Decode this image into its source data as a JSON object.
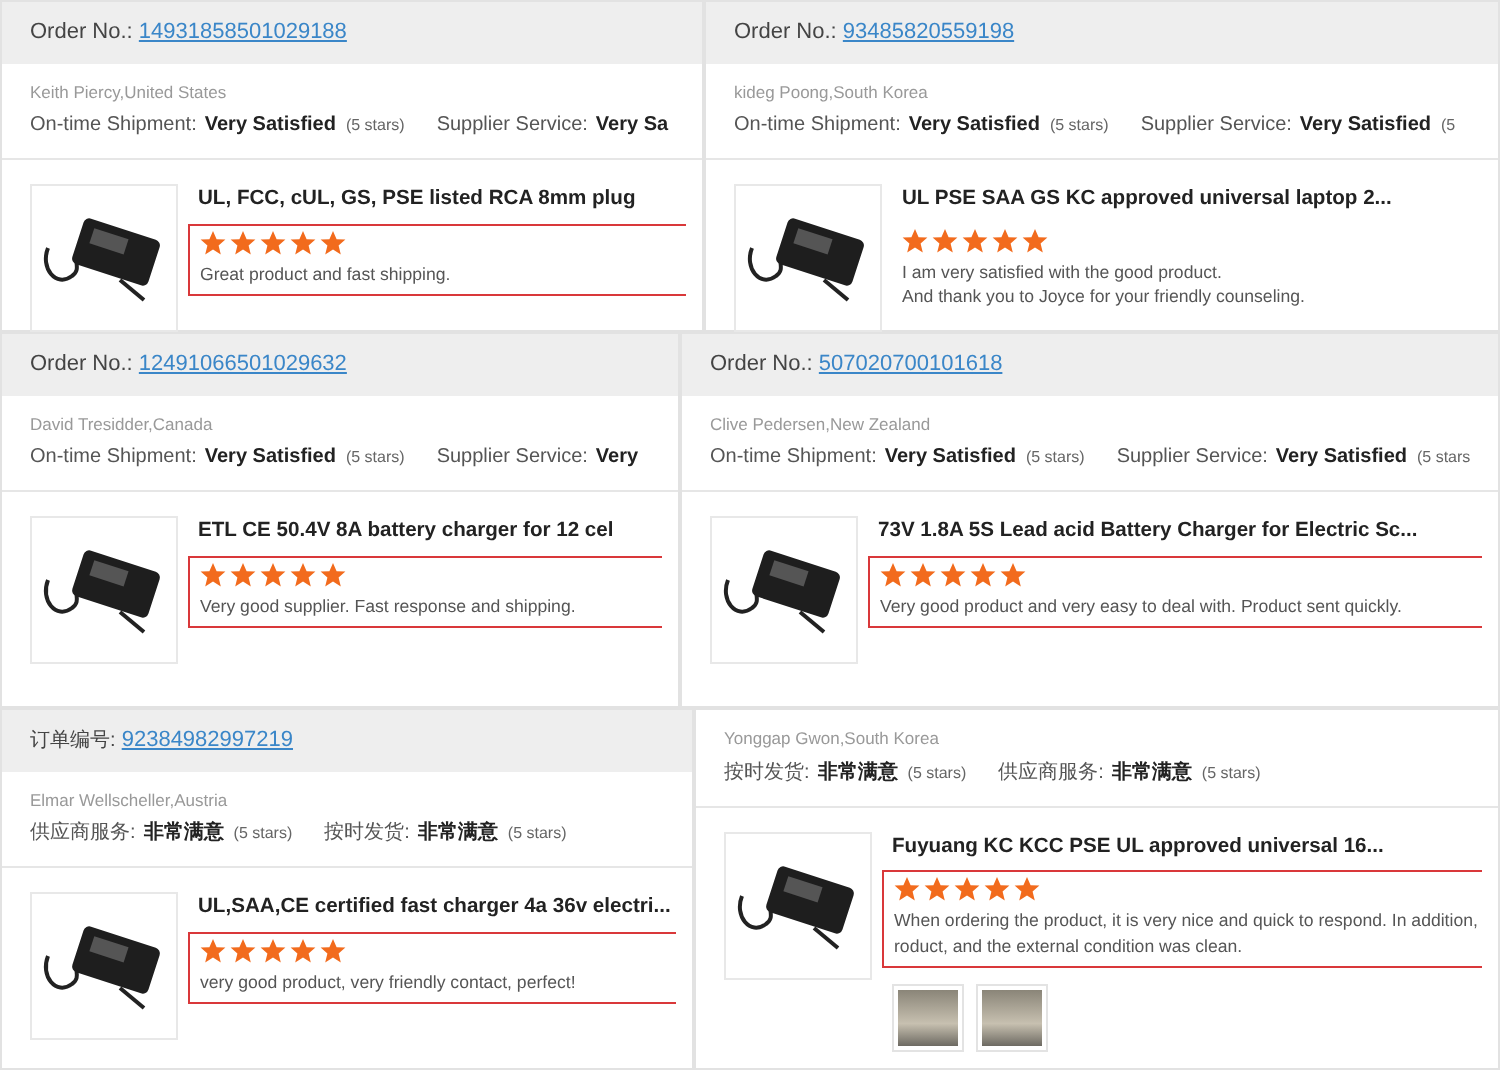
{
  "rows": [
    {
      "cards": [
        {
          "order": {
            "label": "Order No.:",
            "number": "14931858501029188"
          },
          "reviewer": "Keith Piercy,United States",
          "ratings": [
            {
              "label": "On-time Shipment:",
              "value": "Very Satisfied",
              "note": "(5 stars)"
            },
            {
              "label": "Supplier Service:",
              "value": "Very Sa"
            }
          ],
          "product": {
            "title": "UL, FCC, cUL, GS, PSE listed RCA 8mm plug",
            "stars": 5,
            "review": [
              "Great product and fast shipping."
            ],
            "framed": true
          }
        },
        {
          "order": {
            "label": "Order No.:",
            "number": "93485820559198"
          },
          "reviewer": "kideg Poong,South Korea",
          "ratings": [
            {
              "label": "On-time Shipment:",
              "value": "Very Satisfied",
              "note": "(5 stars)"
            },
            {
              "label": "Supplier Service:",
              "value": "Very Satisfied",
              "note": "(5"
            }
          ],
          "product": {
            "title": "UL PSE SAA GS KC approved universal laptop 2...",
            "stars": 5,
            "review": [
              "I am very satisfied with the good product.",
              "And thank you to Joyce for your friendly counseling."
            ],
            "framed": false
          }
        }
      ]
    },
    {
      "cards": [
        {
          "order": {
            "label": "Order No.:",
            "number": "12491066501029632"
          },
          "reviewer": "David Tresidder,Canada",
          "ratings": [
            {
              "label": "On-time Shipment:",
              "value": "Very Satisfied",
              "note": "(5 stars)"
            },
            {
              "label": "Supplier Service:",
              "value": "Very"
            }
          ],
          "product": {
            "title": "ETL CE 50.4V 8A battery charger for 12 cel",
            "stars": 5,
            "review": [
              "Very good supplier. Fast response and shipping."
            ],
            "framed": true
          }
        },
        {
          "order": {
            "label": "Order No.:",
            "number": "507020700101618"
          },
          "reviewer": "Clive Pedersen,New Zealand",
          "ratings": [
            {
              "label": "On-time Shipment:",
              "value": "Very Satisfied",
              "note": "(5 stars)"
            },
            {
              "label": "Supplier Service:",
              "value": "Very Satisfied",
              "note": "(5 stars"
            }
          ],
          "product": {
            "title": "73V 1.8A 5S Lead acid Battery Charger for Electric Sc...",
            "stars": 5,
            "review": [
              "Very good product and very easy to deal with. Product sent quickly."
            ],
            "framed": true
          }
        }
      ]
    },
    {
      "cards": [
        {
          "order": {
            "label": "订单编号:",
            "number": "92384982997219"
          },
          "reviewer": "Elmar Wellscheller,Austria",
          "ratings": [
            {
              "label": "供应商服务:",
              "value": "非常满意",
              "note": "(5 stars)"
            },
            {
              "label": "按时发货:",
              "value": "非常满意",
              "note": "(5 stars)"
            }
          ],
          "product": {
            "title": "UL,SAA,CE certified fast charger 4a 36v electri...",
            "stars": 5,
            "review": [
              "very good product, very friendly contact, perfect!"
            ],
            "framed": true
          }
        },
        {
          "reviewer": "Yonggap Gwon,South Korea",
          "ratings": [
            {
              "label": "按时发货:",
              "value": "非常满意",
              "note": "(5 stars)"
            },
            {
              "label": "供应商服务:",
              "value": "非常满意",
              "note": "(5 stars)"
            }
          ],
          "product": {
            "title": "Fuyuang KC KCC PSE UL approved universal 16...",
            "stars": 5,
            "review": [
              "When ordering the product, it is very nice and quick to respond. In addition,",
              "roduct, and the external condition was clean."
            ],
            "framed": true,
            "photos": [
              {
                "kind": "photo"
              },
              {
                "kind": "photo"
              }
            ]
          }
        }
      ]
    }
  ]
}
